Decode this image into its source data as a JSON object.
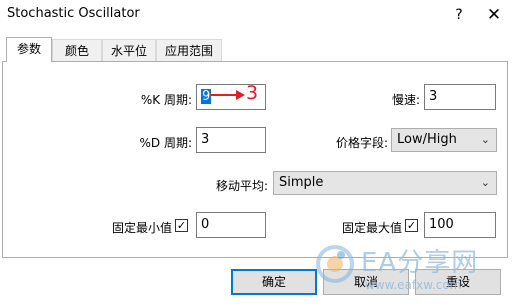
{
  "window": {
    "title": "Stochastic Oscillator",
    "help_label": "?",
    "close_label": "✕"
  },
  "tabs": [
    {
      "label": "参数",
      "active": true
    },
    {
      "label": "颜色",
      "active": false
    },
    {
      "label": "水平位",
      "active": false
    },
    {
      "label": "应用范围",
      "active": false
    }
  ],
  "params": {
    "k_period": {
      "label": "%K 周期:",
      "value": "9"
    },
    "slowing": {
      "label": "慢速:",
      "value": "3"
    },
    "d_period": {
      "label": "%D 周期:",
      "value": "3"
    },
    "price_field": {
      "label": "价格字段:",
      "value": "Low/High"
    },
    "ma_method": {
      "label": "移动平均:",
      "value": "Simple"
    },
    "fixed_min": {
      "label": "固定最小值",
      "checked": true,
      "value": "0"
    },
    "fixed_max": {
      "label": "固定最大值",
      "checked": true,
      "value": "100"
    }
  },
  "annotation": {
    "arrow_text": "3",
    "color": "#e02020"
  },
  "buttons": {
    "ok": "确定",
    "cancel": "取消",
    "reset": "重设"
  },
  "watermark": {
    "text": "EA分享网",
    "url": "www.eafxw.com"
  }
}
